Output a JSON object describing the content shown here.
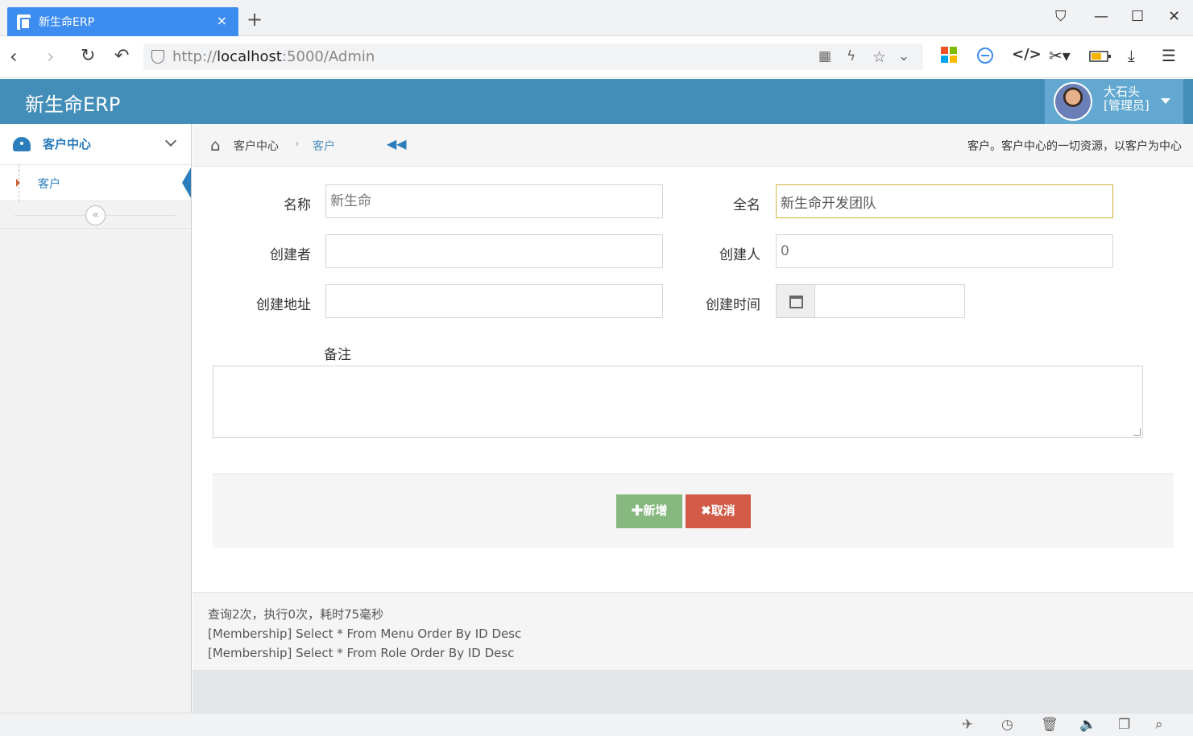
{
  "browser": {
    "tab_title": "新生命ERP",
    "tab_close": "×",
    "new_tab": "+",
    "url_prefix": "http://",
    "url_host": "localhost",
    "url_rest": ":5000/Admin"
  },
  "app": {
    "brand": "新生命ERP",
    "user_name": "大石头",
    "user_role": "[管理员]"
  },
  "sidebar": {
    "group_label": "客户中心",
    "item_label": "客户",
    "collapse_glyph": "«"
  },
  "breadcrumb": {
    "level1": "客户中心",
    "separator": "›",
    "level2": "客户",
    "description": "客户。客户中心的一切资源，以客户为中心"
  },
  "form": {
    "name_label": "名称",
    "name_placeholder": "新生命",
    "fullname_label": "全名",
    "fullname_value": "新生命开发团队",
    "creator_label": "创建者",
    "creator_value": "",
    "creator_id_label": "创建人",
    "creator_id_placeholder": "0",
    "address_label": "创建地址",
    "address_value": "",
    "time_label": "创建时间",
    "time_value": "",
    "remark_label": "备注",
    "add_button": "✚新增",
    "cancel_button": "✖取消"
  },
  "log": {
    "summary": "查询2次，执行0次，耗时75毫秒",
    "line1": "[Membership] Select * From Menu Order By ID Desc",
    "line2": "[Membership] Select * From Role Order By ID Desc"
  },
  "colors": {
    "header": "#438eb9",
    "primary": "#2b7dbc",
    "success": "#87b87f",
    "danger": "#d15b47",
    "focus_border": "#d3b23e"
  }
}
